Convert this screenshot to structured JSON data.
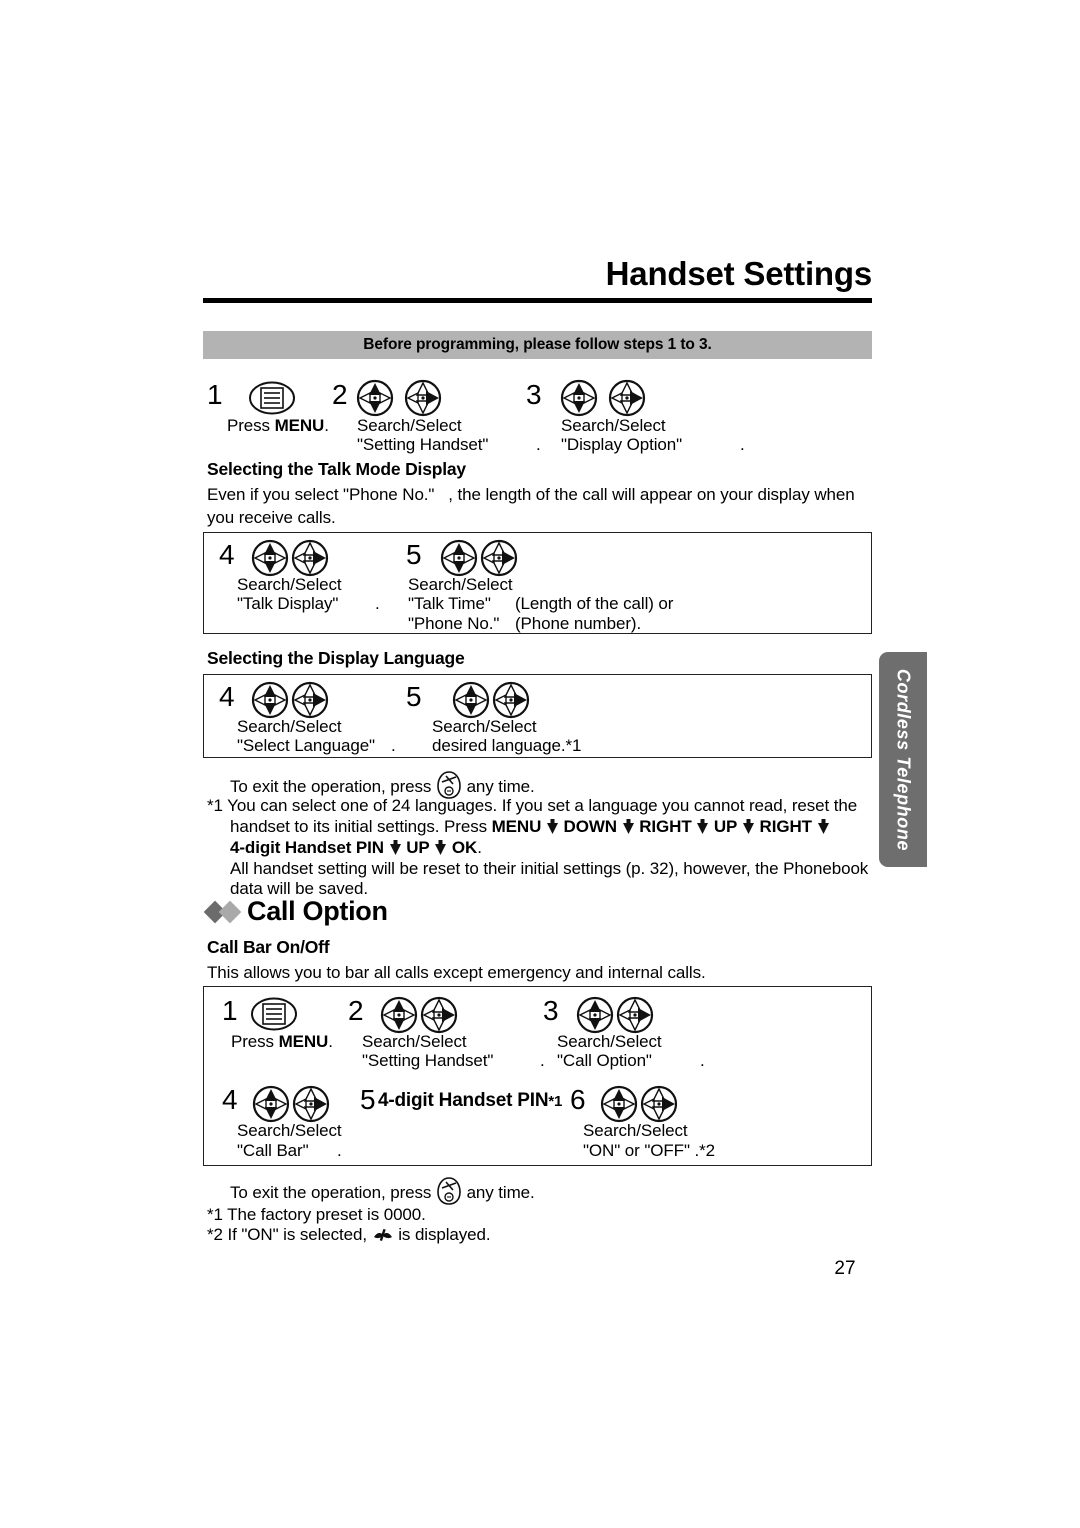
{
  "document": {
    "page_title": "Handset Settings",
    "page_number": "27",
    "side_tab_label": "Cordless Telephone",
    "banner": "Before programming, please follow steps 1 to 3."
  },
  "intro_steps": [
    {
      "num": "1",
      "icon": "menu-icon",
      "line1": "Press ",
      "bold": "MENU",
      "line1_tail": ".",
      "line2": "",
      "line3": ""
    },
    {
      "num": "2",
      "icon": "nav-pair-icon",
      "line1": "Search/Select",
      "line2": "\"Setting Handset\"",
      "line3": "."
    },
    {
      "num": "3",
      "icon": "nav-pair-icon",
      "line1": "Search/Select",
      "line2": "\"Display Option\"",
      "line3": "."
    }
  ],
  "talk_mode": {
    "heading": "Selecting the Talk Mode Display",
    "body_line1": "Even if you select \"Phone No.\"",
    "body_line1b": ", the length of the call will appear on your display when",
    "body_line2": "you receive calls.",
    "steps": [
      {
        "num": "4",
        "line1": "Search/Select",
        "line2": "\"Talk Display\"",
        "line3": "."
      },
      {
        "num": "5",
        "line1": "Search/Select",
        "line2": "\"Talk Time\"",
        "line2b": "(Length of the call) or",
        "line3": "\"Phone No.\"",
        "line3b": "(Phone number)."
      }
    ]
  },
  "display_language": {
    "heading": "Selecting the Display Language",
    "steps": [
      {
        "num": "4",
        "line1": "Search/Select",
        "line2": "\"Select Language\"",
        "line3": "."
      },
      {
        "num": "5",
        "line1": "Search/Select",
        "line2": "desired language.*1"
      }
    ],
    "exit_note_before": "To exit the operation, press",
    "exit_note_after": "any time.",
    "footnote1_line1": "*1 You can select one of 24 languages. If you set a language you cannot read, reset the",
    "footnote1_line2_a": "handset to its initial settings. Press ",
    "footnote1_menu": "MENU",
    "footnote1_down": "DOWN",
    "footnote1_right1": "RIGHT",
    "footnote1_up1": "UP",
    "footnote1_right2": "RIGHT",
    "footnote1_line3_pin": "4-digit Handset PIN",
    "footnote1_up2": "UP",
    "footnote1_ok": "OK",
    "footnote1_ok_tail": ".",
    "footnote1_line4": "All handset setting will be reset to their initial settings (p. 32), however, the Phonebook",
    "footnote1_line5": "data will be saved."
  },
  "call_option": {
    "heading": "Call Option",
    "sub_heading": "Call Bar On/Off",
    "description": "This allows you to bar all calls except emergency and internal calls.",
    "steps": [
      {
        "num": "1",
        "icon": "menu-icon",
        "line1_a": "Press ",
        "line1_bold": "MENU",
        "line1_tail": "."
      },
      {
        "num": "2",
        "icon": "nav-pair-icon",
        "line1": "Search/Select",
        "line2": "\"Setting Handset\"",
        "line3": "."
      },
      {
        "num": "3",
        "icon": "nav-pair-icon",
        "line1": "Search/Select",
        "line2": "\"Call Option\"",
        "line3": "."
      },
      {
        "num": "4",
        "icon": "nav-pair-icon",
        "line1": "Search/Select",
        "line2": "\"Call Bar\"",
        "line3": "."
      },
      {
        "num": "5",
        "icon": "none",
        "label": "4-digit Handset PIN",
        "label_sup": "*1"
      },
      {
        "num": "6",
        "icon": "nav-pair-icon",
        "line1": "Search/Select",
        "line2": "\"ON\"  or \"OFF\" .*2"
      }
    ],
    "exit_note_before": "To exit the operation, press",
    "exit_note_after": "any time.",
    "footnote1": "*1 The factory preset is 0000.",
    "footnote2_a": "*2 If \"ON\"  is selected,",
    "footnote2_b": "is displayed."
  },
  "colors": {
    "banner_gray": "#b3b3b3",
    "tab_gray": "#6e6e6e",
    "diamond_dark": "#6b6b6b",
    "diamond_light": "#a9a9a9"
  }
}
